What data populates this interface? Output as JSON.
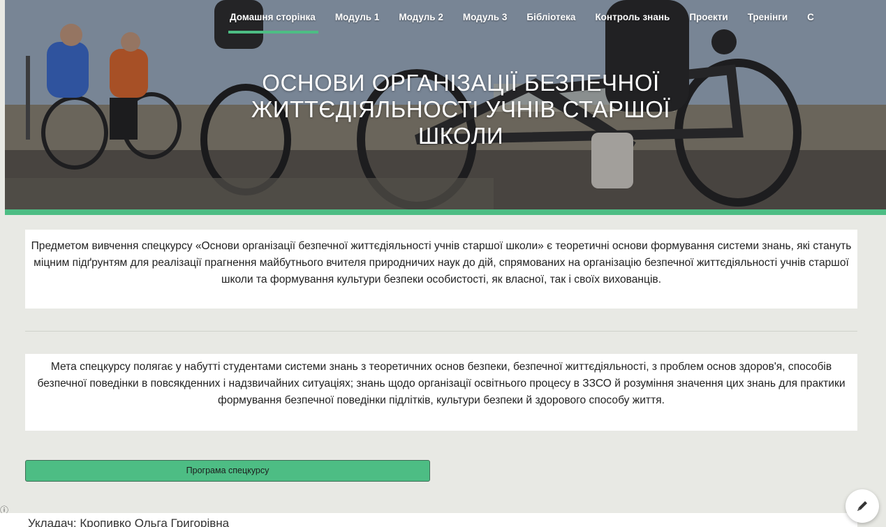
{
  "nav": {
    "items": [
      {
        "label": "Домашня сторінка",
        "active": true
      },
      {
        "label": "Модуль 1"
      },
      {
        "label": "Модуль 2"
      },
      {
        "label": "Модуль 3"
      },
      {
        "label": "Бібліотека"
      },
      {
        "label": "Контроль знань"
      },
      {
        "label": "Проекти"
      },
      {
        "label": "Тренінги"
      },
      {
        "label": "С"
      }
    ]
  },
  "hero": {
    "title_line1": "ОСНОВИ ОРГАНІЗАЦІЇ БЕЗПЕЧНОЇ",
    "title_line2": "ЖИТТЄДІЯЛЬНОСТІ УЧНІВ СТАРШОЇ",
    "title_line3": "ШКОЛИ"
  },
  "content": {
    "subject_text": "Предметом вивчення спецкурсу «Основи організації безпечної життєдіяльності учнів старшої школи» є теоретичні основи формування системи знань, які стануть міцним підґрунтям для реалізації прагнення майбутнього вчителя природничих наук до дій, спрямованих на організацію безпечної життєдіяльності учнів старшої школи та формування культури безпеки особистості, як власної, так і своїх вихованців.",
    "goal_text": "Мета спецкурсу полягає у набутті студентами системи знань з теоретичних основ безпеки, безпечної життєдіяльності, з проблем основ здоров'я, способів безпечної поведінки в повсякденних і надзвичайних ситуаціях; знань щодо організації освітнього процесу в ЗЗСО й розуміння значення цих знань для практики формування безпечної поведінки підлітків, культури безпеки й здорового способу життя.",
    "program_button": "Програма спецкурсу",
    "author_text": "Укладач: Кропивко Ольга Григорівна"
  },
  "colors": {
    "accent": "#4dbd84",
    "page_bg": "#e8e9e4"
  },
  "icons": {
    "info": "info-icon",
    "edit": "pencil-icon"
  }
}
